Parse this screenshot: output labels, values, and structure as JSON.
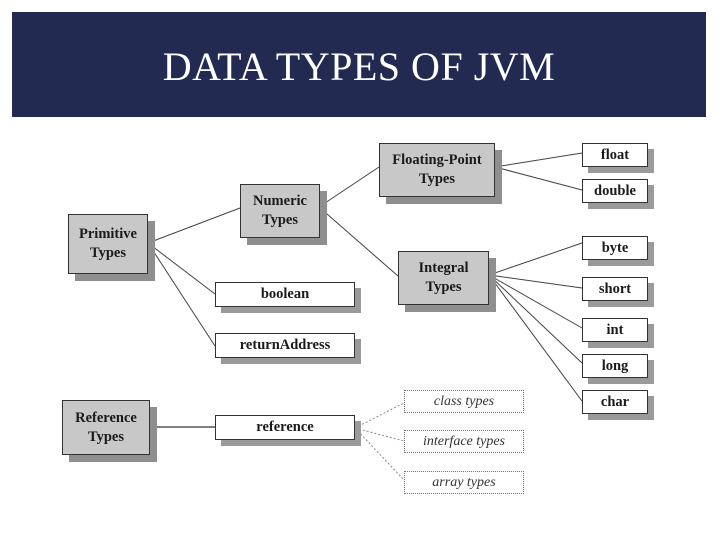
{
  "header": {
    "title": "DATA TYPES OF JVM"
  },
  "colors": {
    "banner": "#232a52",
    "category_fill": "#c8c8c8",
    "leaf_fill": "#ffffff",
    "shadow": "#8f8f8f"
  },
  "diagram": {
    "nodes": {
      "primitive": "Primitive Types",
      "numeric": "Numeric Types",
      "floating": "Floating-Point Types",
      "integral": "Integral Types",
      "boolean": "boolean",
      "returnAddress": "returnAddress",
      "float": "float",
      "double": "double",
      "byte": "byte",
      "short": "short",
      "int": "int",
      "long": "long",
      "char": "char",
      "referenceTypes": "Reference Types",
      "reference": "reference",
      "classTypes": "class types",
      "interfaceTypes": "interface types",
      "arrayTypes": "array types"
    },
    "edges": [
      [
        "primitive",
        "numeric"
      ],
      [
        "primitive",
        "boolean"
      ],
      [
        "primitive",
        "returnAddress"
      ],
      [
        "numeric",
        "floating"
      ],
      [
        "numeric",
        "integral"
      ],
      [
        "floating",
        "float"
      ],
      [
        "floating",
        "double"
      ],
      [
        "integral",
        "byte"
      ],
      [
        "integral",
        "short"
      ],
      [
        "integral",
        "int"
      ],
      [
        "integral",
        "long"
      ],
      [
        "integral",
        "char"
      ],
      [
        "referenceTypes",
        "reference"
      ],
      [
        "reference",
        "classTypes",
        "dotted"
      ],
      [
        "reference",
        "interfaceTypes",
        "dotted"
      ],
      [
        "reference",
        "arrayTypes",
        "dotted"
      ]
    ]
  }
}
